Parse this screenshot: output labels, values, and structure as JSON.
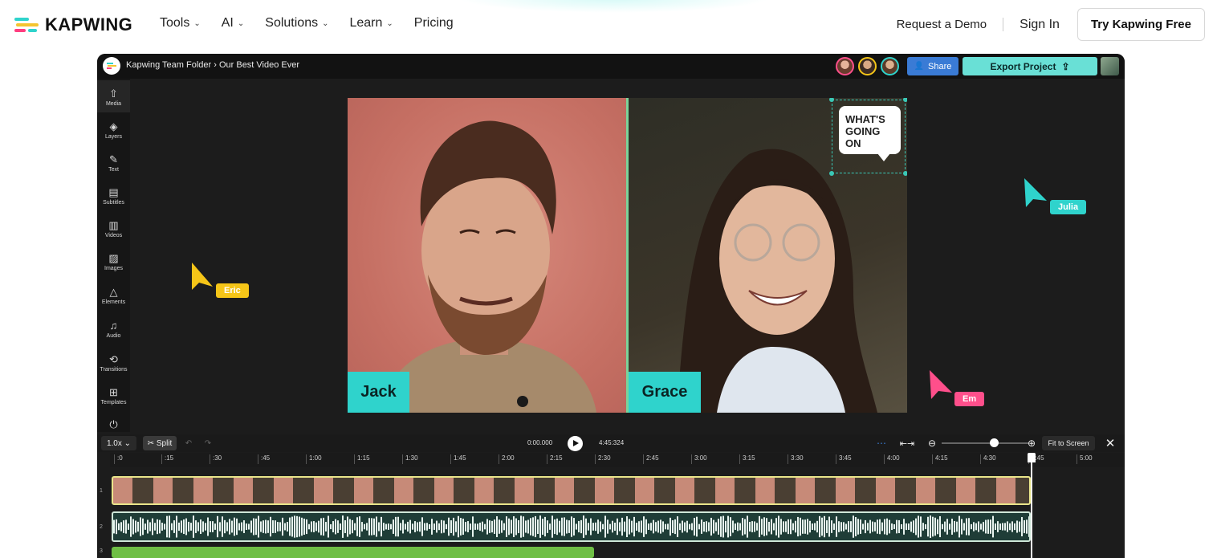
{
  "topnav": {
    "brand": "KAPWING",
    "links": [
      "Tools",
      "AI",
      "Solutions",
      "Learn",
      "Pricing"
    ],
    "request_demo": "Request a Demo",
    "sign_in": "Sign In",
    "try_free": "Try Kapwing Free",
    "colors": {
      "logo_cyan": "#2fd3cc",
      "logo_yellow": "#f4c430",
      "logo_pink": "#ff3d7f"
    }
  },
  "editor": {
    "breadcrumb": "Kapwing Team Folder ›  Our Best Video Ever",
    "share_label": "Share",
    "export_label": "Export Project",
    "sidebar": [
      {
        "label": "Media",
        "icon": "upload-cloud-icon"
      },
      {
        "label": "Layers",
        "icon": "layers-icon"
      },
      {
        "label": "Text",
        "icon": "text-edit-icon"
      },
      {
        "label": "Subtitles",
        "icon": "subtitles-icon"
      },
      {
        "label": "Videos",
        "icon": "film-icon"
      },
      {
        "label": "Images",
        "icon": "image-icon"
      },
      {
        "label": "Elements",
        "icon": "shapes-icon"
      },
      {
        "label": "Audio",
        "icon": "music-note-icon"
      },
      {
        "label": "Transitions",
        "icon": "transition-icon"
      },
      {
        "label": "Templates",
        "icon": "grid-icon"
      }
    ],
    "canvas": {
      "left_name": "Jack",
      "right_name": "Grace",
      "sticker_text": [
        "WHAT'S",
        "GOING",
        "ON"
      ]
    },
    "cursors": [
      {
        "name": "Eric",
        "color": "#f5c518"
      },
      {
        "name": "Julia",
        "color": "#2fd3cc"
      },
      {
        "name": "Em",
        "color": "#ff4f8b"
      }
    ],
    "timeline": {
      "speed": "1.0x",
      "split": "Split",
      "current_time": "0:00.000",
      "total_time": "4:45:324",
      "fit_label": "Fit to Screen",
      "ruler": [
        ":0",
        ":15",
        ":30",
        ":45",
        "1:00",
        "1:15",
        "1:30",
        "1:45",
        "2:00",
        "2:15",
        "2:30",
        "2:45",
        "3:00",
        "3:15",
        "3:30",
        "3:45",
        "4:00",
        "4:15",
        "4:30",
        "4:45",
        "5:00"
      ],
      "track_numbers": [
        "1",
        "2",
        "3"
      ]
    }
  }
}
